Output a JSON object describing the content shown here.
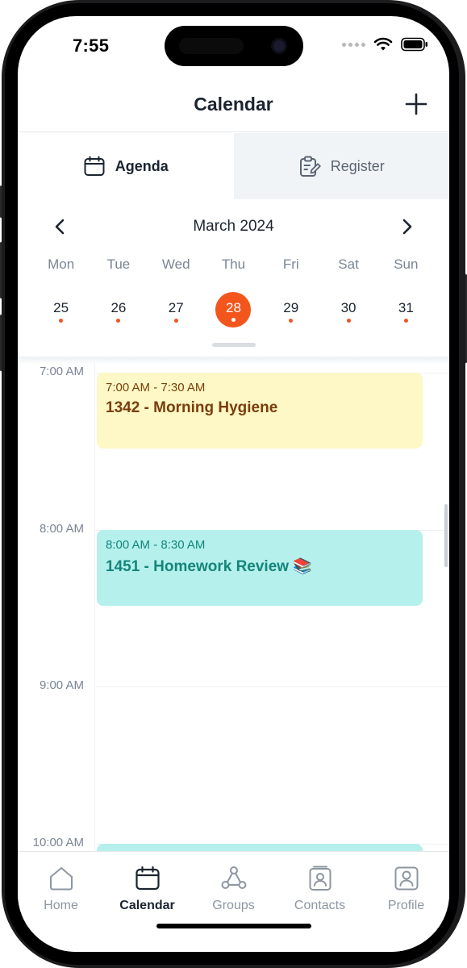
{
  "status_bar": {
    "time": "7:55"
  },
  "header": {
    "title": "Calendar",
    "add_icon": "plus-icon"
  },
  "view_tabs": [
    {
      "label": "Agenda",
      "icon": "calendar-icon",
      "active": true
    },
    {
      "label": "Register",
      "icon": "clipboard-edit-icon",
      "active": false
    }
  ],
  "calendar": {
    "month_label": "March 2024",
    "weekdays": [
      "Mon",
      "Tue",
      "Wed",
      "Thu",
      "Fri",
      "Sat",
      "Sun"
    ],
    "days": [
      "25",
      "26",
      "27",
      "28",
      "29",
      "30",
      "31"
    ],
    "selected_day": "28",
    "accent_color": "#f2561d"
  },
  "timeline": {
    "hours": [
      "7:00 AM",
      "8:00 AM",
      "9:00 AM",
      "10:00 AM"
    ],
    "events": [
      {
        "time": "7:00 AM - 7:30 AM",
        "title": "1342 - Morning Hygiene",
        "color": "#fdf8c5"
      },
      {
        "time": "8:00 AM - 8:30 AM",
        "title": "1451 - Homework Review 📚",
        "color": "#b5f0ec"
      }
    ]
  },
  "tab_bar": [
    {
      "label": "Home",
      "icon": "home-icon",
      "active": false
    },
    {
      "label": "Calendar",
      "icon": "calendar-icon",
      "active": true
    },
    {
      "label": "Groups",
      "icon": "groups-icon",
      "active": false
    },
    {
      "label": "Contacts",
      "icon": "contacts-icon",
      "active": false
    },
    {
      "label": "Profile",
      "icon": "profile-icon",
      "active": false
    }
  ]
}
